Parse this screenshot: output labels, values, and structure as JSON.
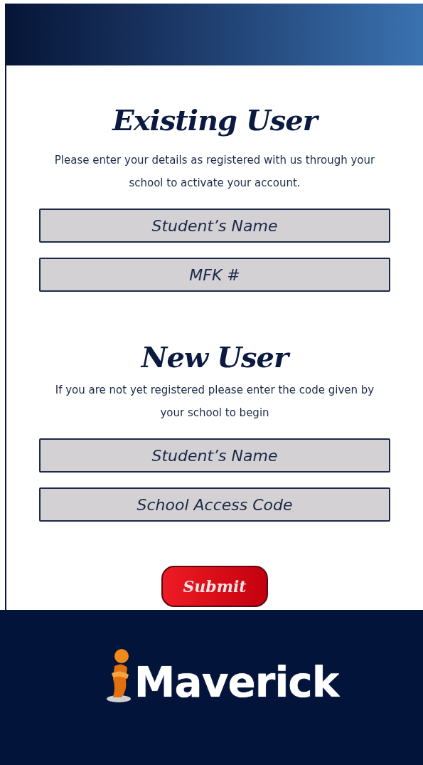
{
  "sections": [
    {
      "title": "Existing User",
      "description": "Please enter your details as registered with us through your school to activate your account.",
      "fields": [
        {
          "placeholder": "Student’s Name"
        },
        {
          "placeholder": "MFK #"
        }
      ]
    },
    {
      "title": "New User",
      "description": "If you are not yet registered please enter the code given by your school to begin",
      "fields": [
        {
          "placeholder": "Student’s Name"
        },
        {
          "placeholder": "School Access Code"
        }
      ]
    }
  ],
  "submit": {
    "label": "Submit"
  },
  "logo": {
    "text": "Maverick"
  }
}
